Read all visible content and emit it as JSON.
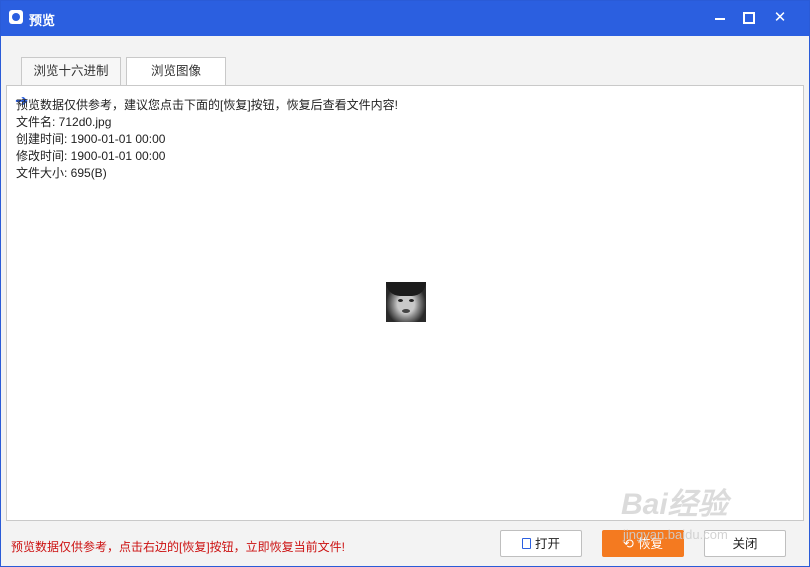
{
  "window": {
    "title": "预览"
  },
  "tabs": [
    {
      "label": "浏览十六进制"
    },
    {
      "label": "浏览图像"
    }
  ],
  "info": {
    "notice": "预览数据仅供参考，建议您点击下面的[恢复]按钮，恢复后查看文件内容!",
    "filename": "文件名: 712d0.jpg",
    "created": "创建时间: 1900-01-01  00:00",
    "modified": "修改时间: 1900-01-01  00:00",
    "size": "文件大小: 695(B)"
  },
  "footer": {
    "note": "预览数据仅供参考，点击右边的[恢复]按钮，立即恢复当前文件!",
    "open_label": "打开",
    "restore_label": "恢复",
    "close_label": "关闭"
  },
  "watermark": {
    "main": "Bai经验",
    "sub": "jingyan.baidu.com"
  },
  "colors": {
    "titlebar": "#2b5fe0",
    "restore_button": "#f47a20",
    "footer_note": "#cc1111"
  }
}
